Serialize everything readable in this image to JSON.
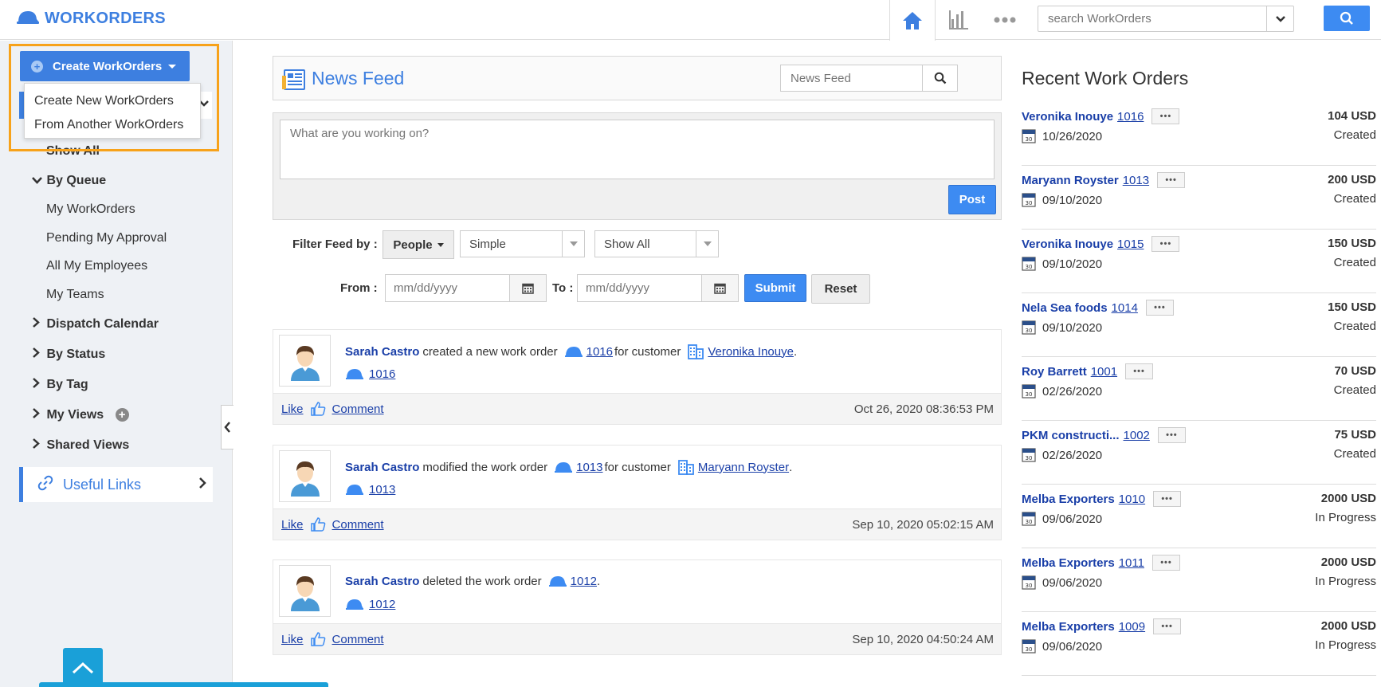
{
  "app": {
    "title": "WORKORDERS"
  },
  "top_search": {
    "placeholder": "search WorkOrders"
  },
  "sidebar": {
    "create_label": "Create WorkOrders",
    "create_menu": [
      "Create New WorkOrders",
      "From Another WorkOrders"
    ],
    "show_all": "Show All",
    "by_queue": "By Queue",
    "queue_items": [
      "My WorkOrders",
      "Pending My Approval",
      "All My Employees",
      "My Teams"
    ],
    "sections": [
      "Dispatch Calendar",
      "By Status",
      "By Tag",
      "My Views",
      "Shared Views"
    ],
    "useful_links": "Useful Links"
  },
  "news_feed": {
    "title": "News Feed",
    "search_placeholder": "News Feed",
    "post_placeholder": "What are you working on?",
    "post_label": "Post",
    "filter_label": "Filter Feed by :",
    "people_label": "People",
    "simple_value": "Simple",
    "show_all_value": "Show All",
    "from_label": "From :",
    "to_label": "To :",
    "date_placeholder": "mm/dd/yyyy",
    "submit_label": "Submit",
    "reset_label": "Reset",
    "like_label": "Like",
    "comment_label": "Comment",
    "items": [
      {
        "user": "Sarah Castro",
        "action": "created a new work order",
        "order": "1016",
        "for_text": "for customer",
        "customer": "Veronika Inouye",
        "ref": "1016",
        "timestamp": "Oct 26, 2020 08:36:53 PM"
      },
      {
        "user": "Sarah Castro",
        "action": "modified the work order",
        "order": "1013",
        "for_text": "for customer",
        "customer": "Maryann Royster",
        "ref": "1013",
        "timestamp": "Sep 10, 2020 05:02:15 AM"
      },
      {
        "user": "Sarah Castro",
        "action": "deleted the work order",
        "order": "1012",
        "for_text": "",
        "customer": "",
        "ref": "1012",
        "timestamp": "Sep 10, 2020 04:50:24 AM"
      }
    ]
  },
  "recent": {
    "title": "Recent Work Orders",
    "items": [
      {
        "name": "Veronika Inouye",
        "num": "1016",
        "date": "10/26/2020",
        "amount": "104 USD",
        "status": "Created"
      },
      {
        "name": "Maryann Royster",
        "num": "1013",
        "date": "09/10/2020",
        "amount": "200 USD",
        "status": "Created"
      },
      {
        "name": "Veronika Inouye",
        "num": "1015",
        "date": "09/10/2020",
        "amount": "150 USD",
        "status": "Created"
      },
      {
        "name": "Nela Sea foods",
        "num": "1014",
        "date": "09/10/2020",
        "amount": "150 USD",
        "status": "Created"
      },
      {
        "name": "Roy Barrett",
        "num": "1001",
        "date": "02/26/2020",
        "amount": "70 USD",
        "status": "Created"
      },
      {
        "name": "PKM constructi...",
        "num": "1002",
        "date": "02/26/2020",
        "amount": "75 USD",
        "status": "Created"
      },
      {
        "name": "Melba Exporters",
        "num": "1010",
        "date": "09/06/2020",
        "amount": "2000 USD",
        "status": "In Progress"
      },
      {
        "name": "Melba Exporters",
        "num": "1011",
        "date": "09/06/2020",
        "amount": "2000 USD",
        "status": "In Progress"
      },
      {
        "name": "Melba Exporters",
        "num": "1009",
        "date": "09/06/2020",
        "amount": "2000 USD",
        "status": "In Progress"
      }
    ]
  },
  "colors": {
    "accent": "#3d7fe0",
    "link": "#1a3fa8",
    "highlight": "#f7a21a",
    "teal": "#1aa0d8"
  }
}
